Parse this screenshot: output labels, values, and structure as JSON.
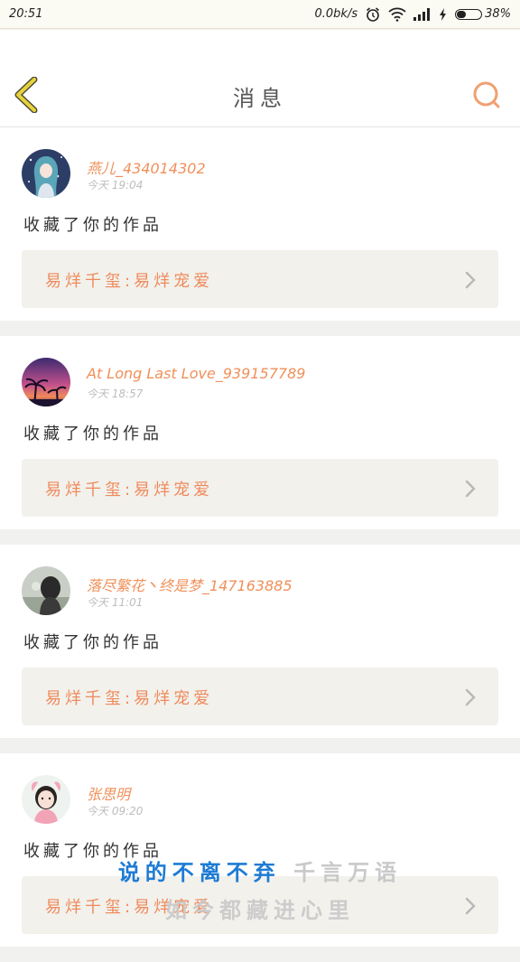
{
  "status_bar": {
    "time": "20:51",
    "speed": "0.0bk/s",
    "battery": "38%",
    "battery_level": 0.38
  },
  "header": {
    "title": "消息"
  },
  "messages": [
    {
      "username": "燕儿_434014302",
      "time": "今天 19:04",
      "action": "收藏了你的作品",
      "work": "易烊千玺:易烊宠爱"
    },
    {
      "username": "At Long Last Love_939157789",
      "time": "今天 18:57",
      "action": "收藏了你的作品",
      "work": "易烊千玺:易烊宠爱"
    },
    {
      "username": "落尽繁花丶终是梦_147163885",
      "time": "今天 11:01",
      "action": "收藏了你的作品",
      "work": "易烊千玺:易烊宠爱"
    },
    {
      "username": "张思明",
      "time": "今天 09:20",
      "action": "收藏了你的作品",
      "work": "易烊千玺:易烊宠爱"
    }
  ],
  "overlay": {
    "line1_a": "说的不离不弃",
    "line1_b": " 千言万语",
    "line2": "如今都藏进心里"
  },
  "colors": {
    "accent": "#f0905a",
    "back_icon": "#e8d23a",
    "overlay_blue": "#1e7bd4"
  }
}
